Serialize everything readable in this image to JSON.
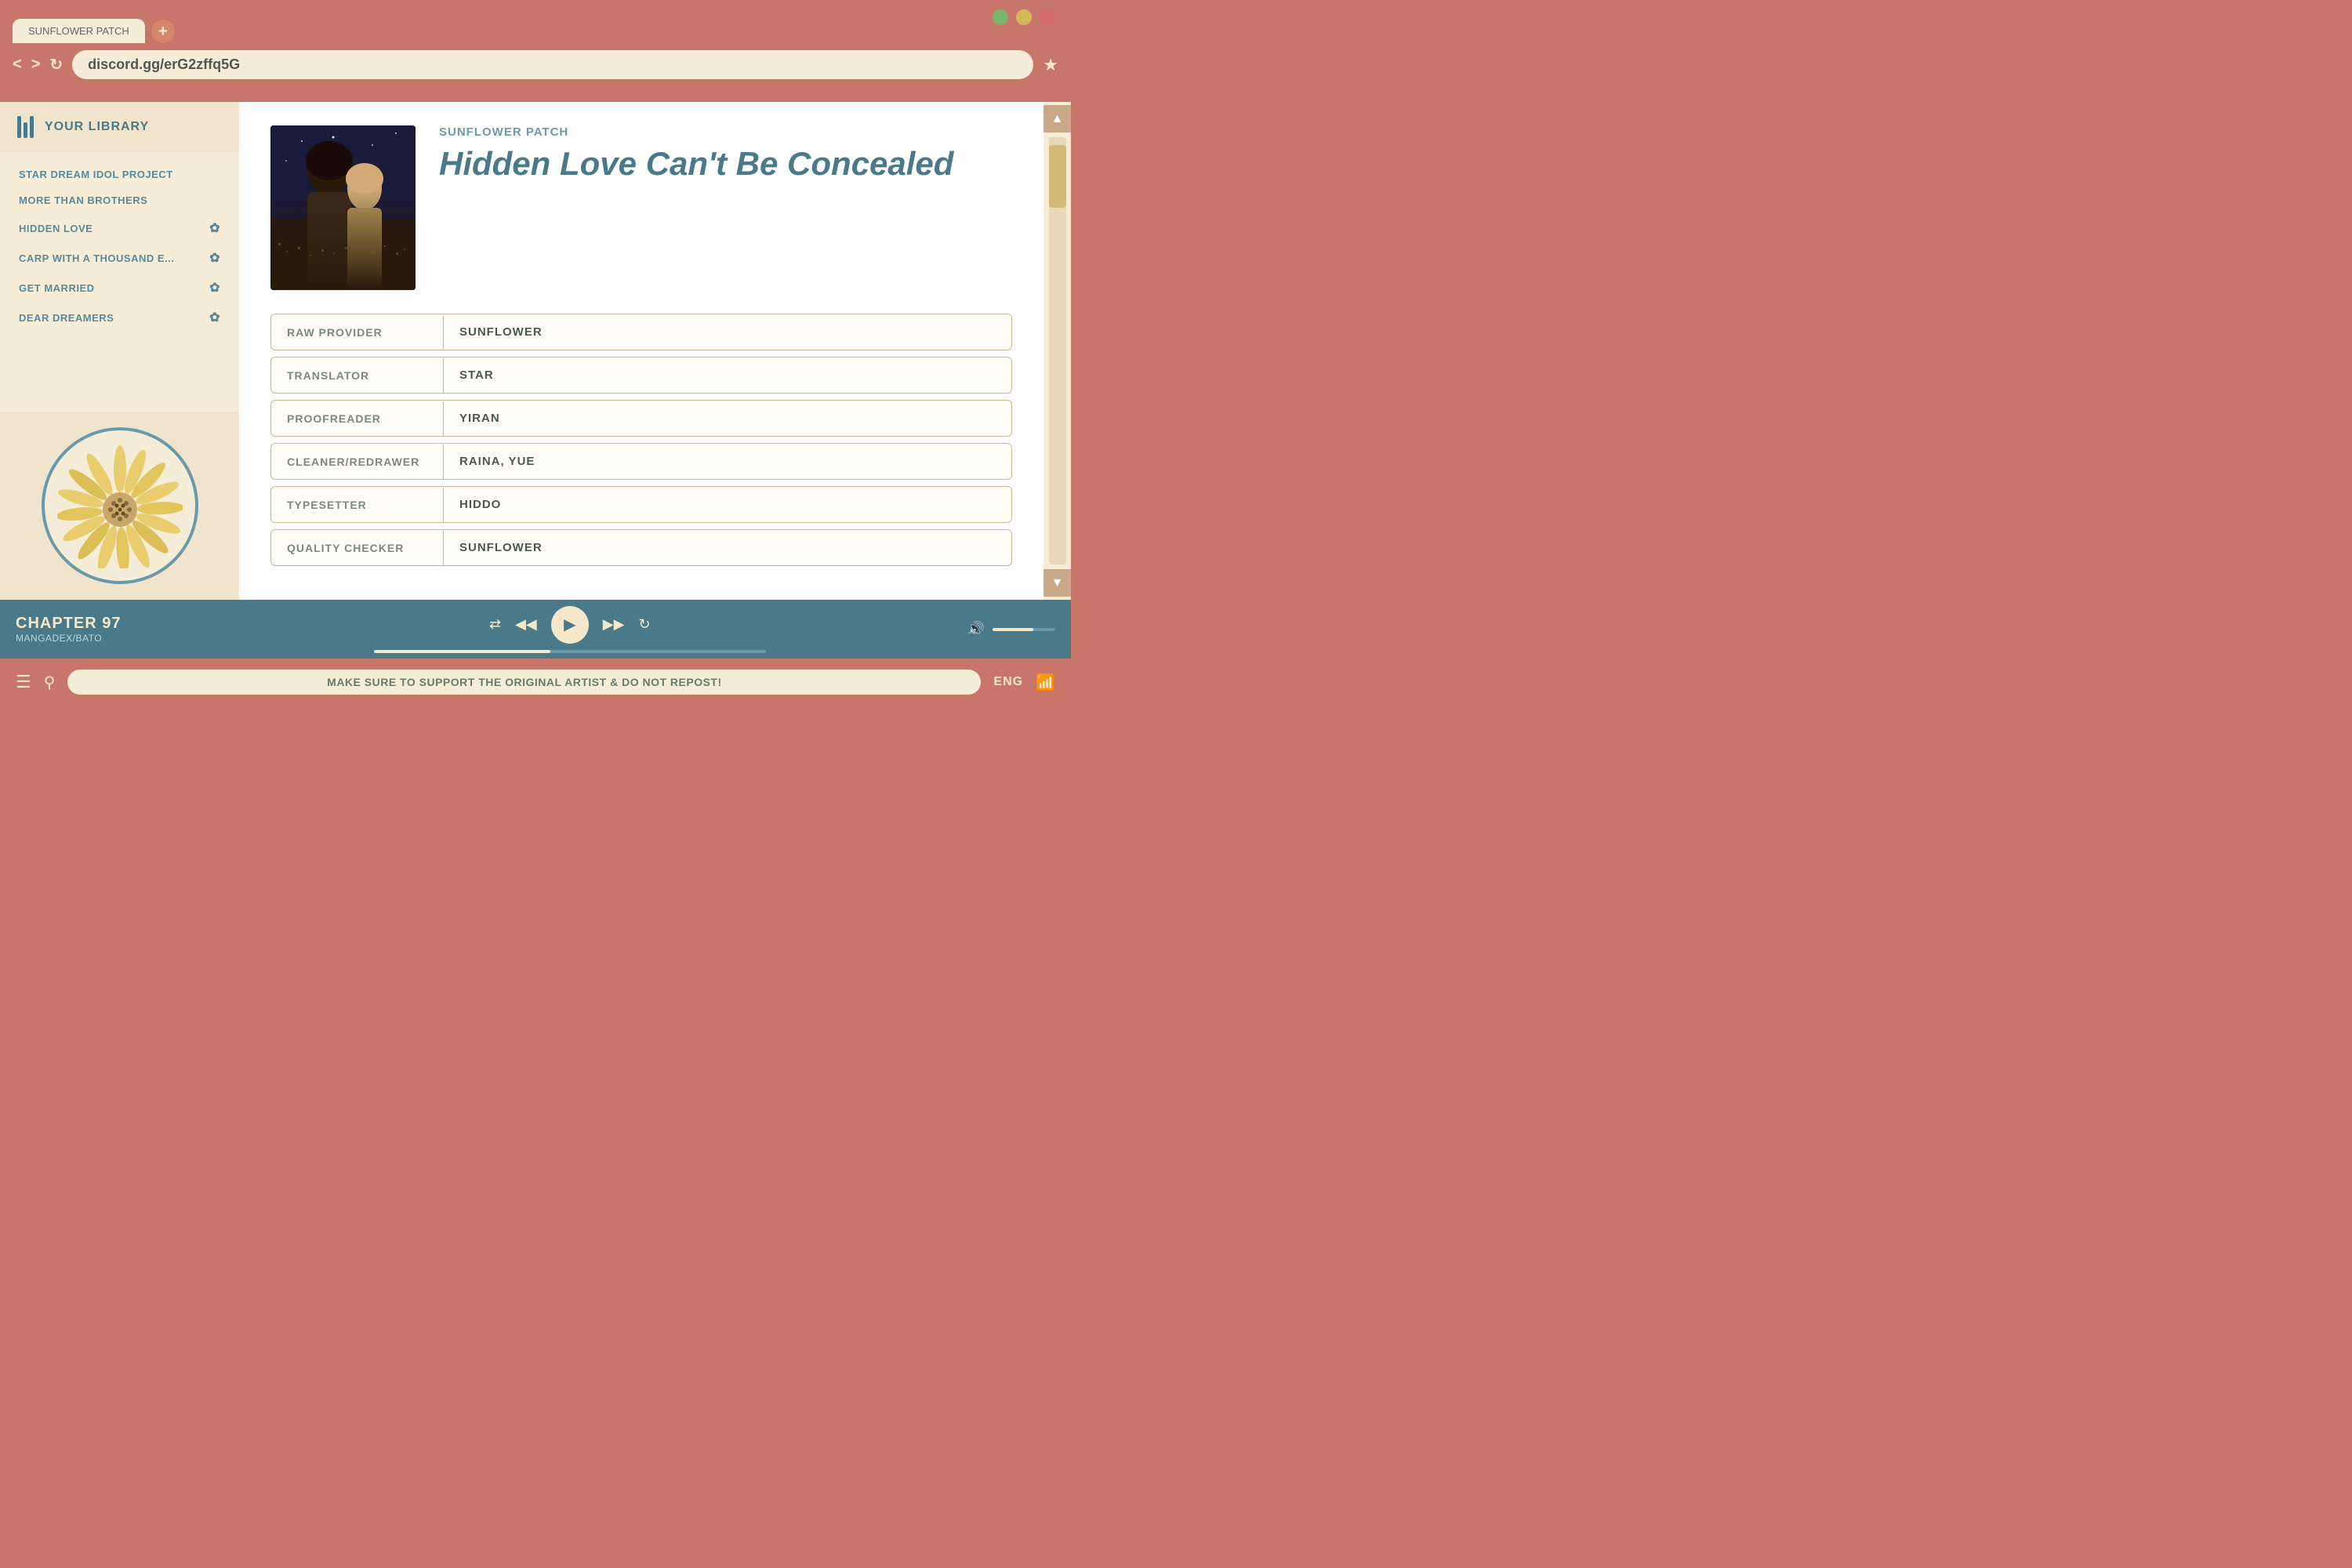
{
  "browser": {
    "url": "discord.gg/erG2zffq5G",
    "tab_title": "Sunflower Patch"
  },
  "sidebar": {
    "header": "YOUR LIBRARY",
    "items": [
      {
        "label": "STAR DREAM IDOL PROJECT",
        "has_icon": false
      },
      {
        "label": "MORE THAN BROTHERS",
        "has_icon": false
      },
      {
        "label": "HIDDEN LOVE",
        "has_icon": true
      },
      {
        "label": "CARP WITH A THOUSAND E...",
        "has_icon": true
      },
      {
        "label": "GET MARRIED",
        "has_icon": true
      },
      {
        "label": "DEAR DREAMERS",
        "has_icon": true
      }
    ]
  },
  "manga": {
    "series": "SUNFLOWER PATCH",
    "title": "Hidden Love Can't Be Concealed"
  },
  "credits": [
    {
      "label": "RAW PROVIDER",
      "value": "SUNFLOWER"
    },
    {
      "label": "TRANSLATOR",
      "value": "STAR"
    },
    {
      "label": "PROOFREADER",
      "value": "YIRAN"
    },
    {
      "label": "CLEANER/REDRAWER",
      "value": "RAINA, YUE"
    },
    {
      "label": "TYPESETTER",
      "value": "HIDDO"
    },
    {
      "label": "QUALITY CHECKER",
      "value": "SUNFLOWER"
    }
  ],
  "player": {
    "chapter": "CHAPTER 97",
    "source": "MANGADEX/BATO"
  },
  "bottom_bar": {
    "notice": "MAKE SURE TO SUPPORT THE ORIGINAL ARTIST & DO NOT REPOST!",
    "lang": "ENG"
  }
}
